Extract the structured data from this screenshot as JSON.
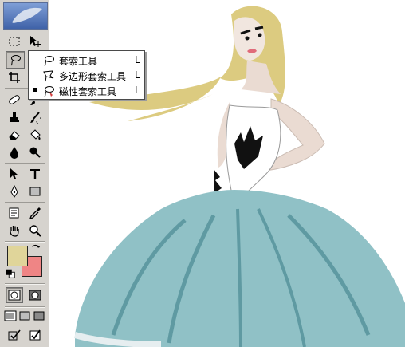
{
  "toolbar": {
    "foreground_color": "#e0d59a",
    "background_color": "#ef8585",
    "tools": [
      "marquee-tool",
      "move-tool",
      "lasso-tool",
      "crop-tool",
      "healing-brush-tool",
      "brush-tool",
      "clone-stamp-tool",
      "history-brush-tool",
      "eraser-tool",
      "paint-bucket-tool",
      "blur-tool",
      "dodge-tool",
      "path-selection-tool",
      "type-tool",
      "pen-tool",
      "shape-tool",
      "notes-tool",
      "eyedropper-tool",
      "hand-tool",
      "zoom-tool"
    ]
  },
  "flyout": {
    "items": [
      {
        "label": "套索工具",
        "shortcut": "L",
        "icon": "lasso-icon"
      },
      {
        "label": "多边形套索工具",
        "shortcut": "L",
        "icon": "polygonal-lasso-icon"
      },
      {
        "label": "磁性套索工具",
        "shortcut": "L",
        "icon": "magnetic-lasso-icon",
        "selected": true
      }
    ]
  },
  "canvas": {
    "colors": {
      "hair": "#dccb80",
      "skin": "#eadbd2",
      "dress": "#90c1c6",
      "dress_dark": "#5f9aa2"
    }
  }
}
